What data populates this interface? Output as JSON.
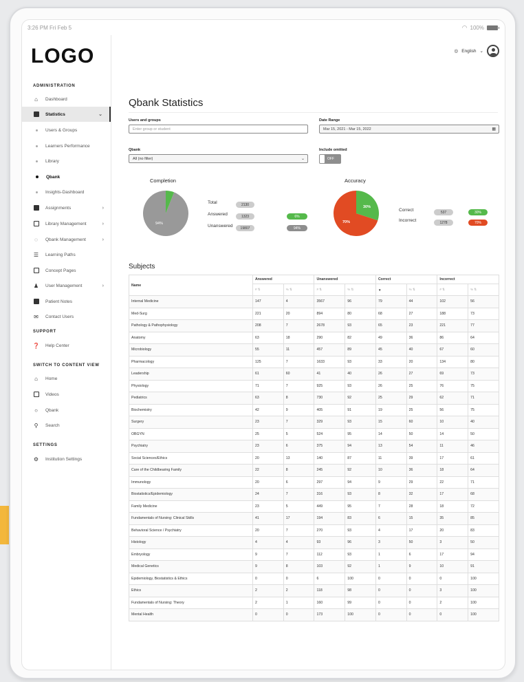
{
  "status": {
    "time": "3:26 PM  Fri Feb 5",
    "battery": "100%"
  },
  "logo": "LOGO",
  "language": "English",
  "sidebar": {
    "administration": {
      "heading": "ADMINISTRATION",
      "items": [
        {
          "label": "Dashboard",
          "icon": "home-icon"
        },
        {
          "label": "Statistics",
          "icon": "chart-icon",
          "active": true
        },
        {
          "label": "Users & Groups",
          "sub": true
        },
        {
          "label": "Learners Performance",
          "sub": true
        },
        {
          "label": "Library",
          "sub": true
        },
        {
          "label": "Qbank",
          "sub": true,
          "current": true
        },
        {
          "label": "Insights-Dashboard",
          "sub": true
        },
        {
          "label": "Assignments",
          "icon": "clipboard-icon"
        },
        {
          "label": "Library Management",
          "icon": "library-icon"
        },
        {
          "label": "Qbank Management",
          "icon": "qbank-icon"
        },
        {
          "label": "Learning Paths",
          "icon": "path-icon"
        },
        {
          "label": "Concept Pages",
          "icon": "pages-icon"
        },
        {
          "label": "User Management",
          "icon": "users-icon"
        },
        {
          "label": "Patient Notes",
          "icon": "notes-icon"
        },
        {
          "label": "Contact Users",
          "icon": "mail-icon"
        }
      ]
    },
    "support": {
      "heading": "SUPPORT",
      "items": [
        {
          "label": "Help Center"
        }
      ]
    },
    "content_view": {
      "heading": "SWITCH TO CONTENT VIEW",
      "items": [
        {
          "label": "Home"
        },
        {
          "label": "Videos"
        },
        {
          "label": "Qbank"
        },
        {
          "label": "Search"
        }
      ]
    },
    "settings": {
      "heading": "SETTINGS",
      "items": [
        {
          "label": "Institution Settings"
        }
      ]
    }
  },
  "page": {
    "title": "Qbank Statistics",
    "users_label": "Users and groups",
    "users_placeholder": "Enter group or student",
    "date_label": "Date Range",
    "date_value": "Mar 15, 2021 - Mar 15, 2022",
    "qbank_label": "Qbank",
    "qbank_value": "All (no filter)",
    "omitted_label": "Include omitted",
    "omitted_value": "OFF"
  },
  "completion": {
    "title": "Completion",
    "slice_label": "94%",
    "total_label": "Total",
    "total_value": "2130",
    "answered_label": "Answered",
    "answered_value": "1323",
    "answered_pct": "6%",
    "unanswered_label": "Unanswered",
    "unanswered_value": "19807",
    "unanswered_pct": "94%",
    "answered_fraction": 0.06,
    "colors": {
      "answered": "#55b94b",
      "unanswered": "#999999"
    }
  },
  "accuracy": {
    "title": "Accuracy",
    "correct_slice": "30%",
    "incorrect_slice": "70%",
    "correct_label": "Correct",
    "correct_value": "537",
    "correct_pct": "30%",
    "incorrect_label": "Incorrect",
    "incorrect_value": "1278",
    "incorrect_pct": "70%",
    "correct_fraction": 0.3,
    "colors": {
      "correct": "#55b94b",
      "incorrect": "#e14b23"
    }
  },
  "subjects": {
    "title": "Subjects",
    "columns": {
      "name": "Name",
      "answered": "Answered",
      "unanswered": "Unanswered",
      "correct": "Correct",
      "incorrect": "Incorrect",
      "num": "#",
      "pct": "%"
    },
    "rows": [
      [
        "Internal Medicine",
        "147",
        "4",
        "3567",
        "96",
        "79",
        "44",
        "102",
        "56"
      ],
      [
        "Med-Surg",
        "221",
        "20",
        "894",
        "80",
        "68",
        "27",
        "188",
        "73"
      ],
      [
        "Pathology & Pathophysiology",
        "208",
        "7",
        "2678",
        "93",
        "65",
        "23",
        "221",
        "77"
      ],
      [
        "Anatomy",
        "63",
        "18",
        "290",
        "82",
        "49",
        "36",
        "86",
        "64"
      ],
      [
        "Microbiology",
        "55",
        "11",
        "457",
        "89",
        "45",
        "40",
        "67",
        "60"
      ],
      [
        "Pharmacology",
        "125",
        "7",
        "1633",
        "93",
        "33",
        "20",
        "134",
        "80"
      ],
      [
        "Leadership",
        "61",
        "60",
        "41",
        "40",
        "26",
        "27",
        "69",
        "73"
      ],
      [
        "Physiology",
        "71",
        "7",
        "925",
        "93",
        "26",
        "25",
        "76",
        "75"
      ],
      [
        "Pediatrics",
        "63",
        "8",
        "730",
        "92",
        "25",
        "29",
        "62",
        "71"
      ],
      [
        "Biochemistry",
        "42",
        "9",
        "405",
        "91",
        "19",
        "25",
        "56",
        "75"
      ],
      [
        "Surgery",
        "23",
        "7",
        "329",
        "93",
        "15",
        "60",
        "10",
        "40"
      ],
      [
        "OBGYN",
        "25",
        "5",
        "524",
        "95",
        "14",
        "50",
        "14",
        "50"
      ],
      [
        "Psychiatry",
        "23",
        "6",
        "375",
        "94",
        "13",
        "54",
        "11",
        "46"
      ],
      [
        "Social Sciences/Ethics",
        "20",
        "13",
        "140",
        "87",
        "11",
        "39",
        "17",
        "61"
      ],
      [
        "Care of the Childbearing Family",
        "22",
        "8",
        "245",
        "92",
        "10",
        "36",
        "18",
        "64"
      ],
      [
        "Immunology",
        "20",
        "6",
        "297",
        "94",
        "9",
        "29",
        "22",
        "71"
      ],
      [
        "Biostatistics/Epidemiology",
        "24",
        "7",
        "316",
        "93",
        "8",
        "32",
        "17",
        "68"
      ],
      [
        "Family Medicine",
        "23",
        "5",
        "449",
        "95",
        "7",
        "28",
        "18",
        "72"
      ],
      [
        "Fundamentals of Nursing: Clinical Skills",
        "41",
        "17",
        "194",
        "83",
        "6",
        "15",
        "35",
        "85"
      ],
      [
        "Behavioral Science / Psychiatry",
        "20",
        "7",
        "270",
        "93",
        "4",
        "17",
        "20",
        "83"
      ],
      [
        "Histology",
        "4",
        "4",
        "93",
        "96",
        "3",
        "50",
        "3",
        "50"
      ],
      [
        "Embryology",
        "9",
        "7",
        "112",
        "93",
        "1",
        "6",
        "17",
        "94"
      ],
      [
        "Medical Genetics",
        "9",
        "8",
        "103",
        "92",
        "1",
        "9",
        "10",
        "91"
      ],
      [
        "Epidemiology, Biostatistics & Ethics",
        "0",
        "0",
        "6",
        "100",
        "0",
        "0",
        "0",
        "100"
      ],
      [
        "Ethics",
        "2",
        "2",
        "118",
        "98",
        "0",
        "0",
        "3",
        "100"
      ],
      [
        "Fundamentals of Nursing: Theory",
        "2",
        "1",
        "160",
        "99",
        "0",
        "0",
        "2",
        "100"
      ],
      [
        "Mental Health",
        "0",
        "0",
        "173",
        "100",
        "0",
        "0",
        "0",
        "100"
      ]
    ]
  }
}
